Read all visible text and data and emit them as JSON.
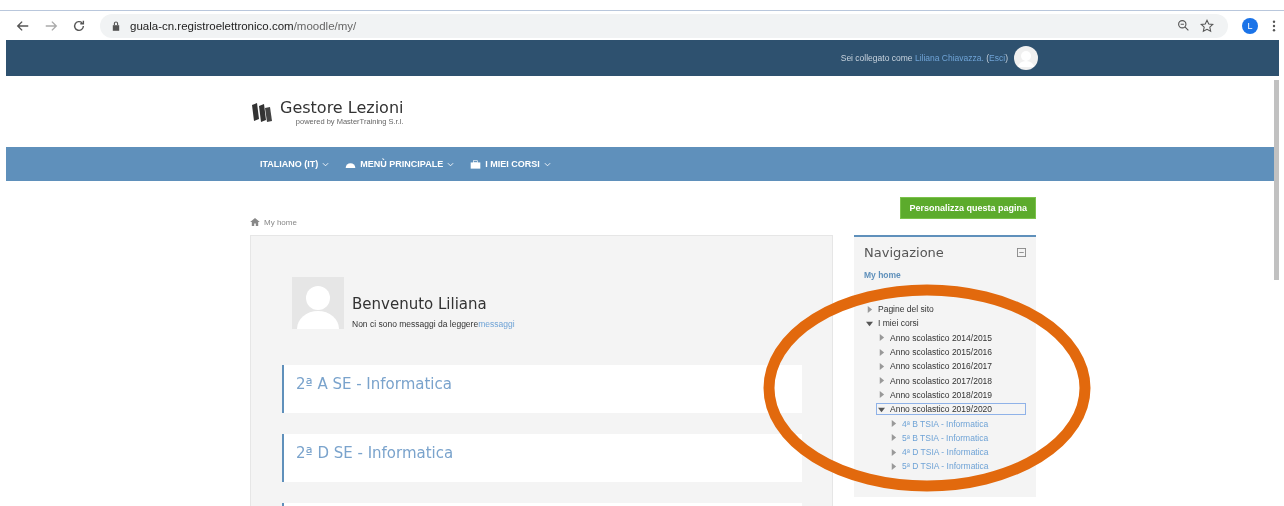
{
  "browser": {
    "url_host": "guala-cn.registroelettronico.com",
    "url_path": "/moodle/my/",
    "profile_initial": "L"
  },
  "header": {
    "logged_in_prefix": "Sei collegato come",
    "user_name": "Liliana Chiavazza.",
    "logout_open": "(",
    "logout": "Esci",
    "logout_close": ")"
  },
  "logo": {
    "title": "Gestore Lezioni",
    "subtitle": "powered by MasterTraining S.r.l."
  },
  "menu": [
    {
      "label": "ITALIANO (IT)",
      "kind": "plain"
    },
    {
      "label": "MENÙ PRINCIPALE",
      "kind": "dashboard"
    },
    {
      "label": "I MIEI CORSI",
      "kind": "briefcase"
    }
  ],
  "breadcrumb": "My home",
  "customize_button": "Personalizza questa pagina",
  "welcome": {
    "title": "Benvenuto Liliana",
    "message": "Non ci sono messaggi da leggere",
    "messages_link": "messaggi"
  },
  "courses": [
    {
      "kind": "course",
      "title": "2ª A SE - Informatica"
    },
    {
      "kind": "course",
      "title": "2ª D SE - Informatica"
    },
    {
      "kind": "cut_off"
    }
  ],
  "navigation": {
    "title": "Navigazione",
    "home": "My home",
    "tree": [
      {
        "label": "Pagine del sito",
        "expanded": false,
        "link": false,
        "selected": false
      },
      {
        "label": "I miei corsi",
        "expanded": true,
        "link": false,
        "selected": false,
        "children": [
          {
            "label": "Anno scolastico 2014/2015",
            "expanded": false,
            "link": false,
            "selected": false
          },
          {
            "label": "Anno scolastico 2015/2016",
            "expanded": false,
            "link": false,
            "selected": false
          },
          {
            "label": "Anno scolastico 2016/2017",
            "expanded": false,
            "link": false,
            "selected": false
          },
          {
            "label": "Anno scolastico 2017/2018",
            "expanded": false,
            "link": false,
            "selected": false
          },
          {
            "label": "Anno scolastico 2018/2019",
            "expanded": false,
            "link": false,
            "selected": false
          },
          {
            "label": "Anno scolastico 2019/2020",
            "expanded": true,
            "link": false,
            "selected": true,
            "children": [
              {
                "label": "4ª B TSIA - Informatica",
                "expanded": false,
                "link": true,
                "selected": false
              },
              {
                "label": "5ª B TSIA - Informatica",
                "expanded": false,
                "link": true,
                "selected": false
              },
              {
                "label": "4ª D TSIA - Informatica",
                "expanded": false,
                "link": true,
                "selected": false
              },
              {
                "label": "5ª D TSIA - Informatica",
                "expanded": false,
                "link": true,
                "selected": false
              }
            ]
          }
        ]
      }
    ]
  }
}
